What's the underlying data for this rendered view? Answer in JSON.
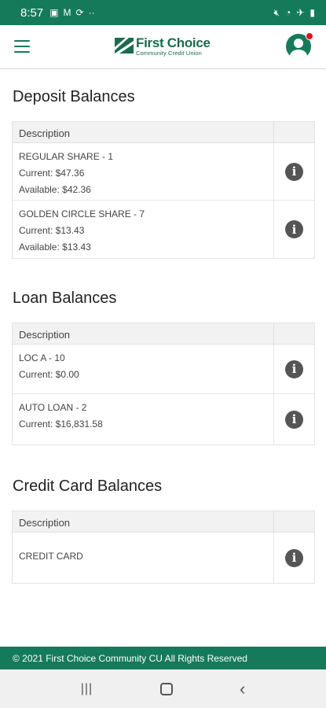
{
  "status_bar": {
    "time": "8:57",
    "left_icons": [
      "photo-icon",
      "gmail-icon",
      "sync-icon",
      "more-icon"
    ],
    "right_icons": [
      "mute-icon",
      "wifi-icon",
      "airplane-icon",
      "battery-icon"
    ]
  },
  "header": {
    "logo_title": "First Choice",
    "logo_subtitle": "Community Credit Union",
    "menu_icon": "hamburger-icon",
    "avatar_icon": "user-icon",
    "notification": true
  },
  "sections": {
    "deposit": {
      "title": "Deposit Balances",
      "header": "Description",
      "rows": [
        {
          "lines": [
            "REGULAR SHARE - 1",
            "Current: $47.36",
            "Available: $42.36"
          ]
        },
        {
          "lines": [
            "GOLDEN CIRCLE SHARE - 7",
            "Current: $13.43",
            "Available: $13.43"
          ]
        }
      ]
    },
    "loan": {
      "title": "Loan Balances",
      "header": "Description",
      "rows": [
        {
          "lines": [
            "LOC A - 10",
            "Current: $0.00"
          ]
        },
        {
          "lines": [
            "AUTO LOAN - 2",
            "Current: $16,831.58"
          ]
        }
      ]
    },
    "credit": {
      "title": "Credit Card Balances",
      "header": "Description",
      "rows": [
        {
          "lines": [
            "CREDIT CARD"
          ]
        }
      ]
    }
  },
  "footer": {
    "text": "© 2021 First Choice Community CU All Rights Reserved"
  },
  "nav": {
    "recent_icon": "recent-apps-icon",
    "home_icon": "home-icon",
    "back_icon": "back-icon"
  },
  "colors": {
    "brand": "#157a5a",
    "notification": "#e0161b",
    "info_icon": "#555555"
  }
}
